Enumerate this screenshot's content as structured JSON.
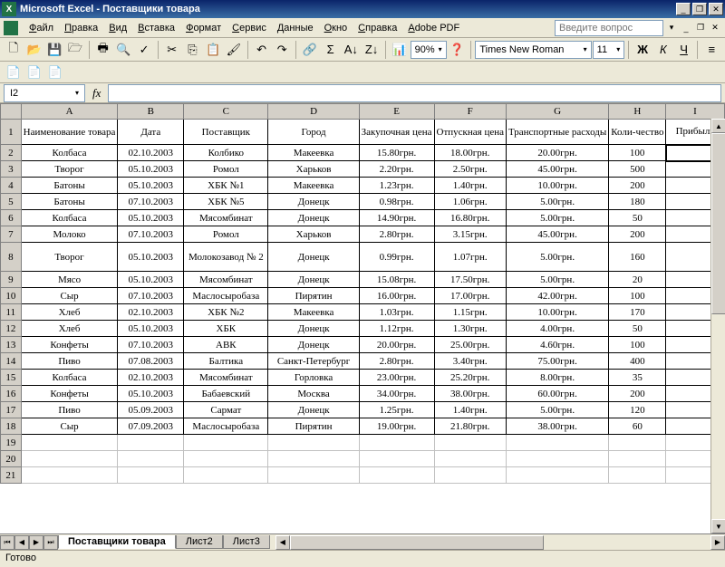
{
  "title": "Microsoft Excel - Поставщики товара",
  "menus": [
    "Файл",
    "Правка",
    "Вид",
    "Вставка",
    "Формат",
    "Сервис",
    "Данные",
    "Окно",
    "Справка",
    "Adobe PDF"
  ],
  "question_placeholder": "Введите вопрос",
  "font_name": "Times New Roman",
  "font_size": "11",
  "zoom": "90%",
  "namebox": "I2",
  "columns": [
    "A",
    "B",
    "C",
    "D",
    "E",
    "F",
    "G",
    "H",
    "I"
  ],
  "headers": [
    "Наименование товара",
    "Дата",
    "Поставщик",
    "Город",
    "Закупочная цена",
    "Отпускная цена",
    "Транспортные расходы",
    "Коли-чество",
    "Прибыль"
  ],
  "rows": [
    [
      "Колбаса",
      "02.10.2003",
      "Колбико",
      "Макеевка",
      "15.80грн.",
      "18.00грн.",
      "20.00грн.",
      "100",
      ""
    ],
    [
      "Творог",
      "05.10.2003",
      "Ромол",
      "Харьков",
      "2.20грн.",
      "2.50грн.",
      "45.00грн.",
      "500",
      ""
    ],
    [
      "Батоны",
      "05.10.2003",
      "ХБК №1",
      "Макеевка",
      "1.23грн.",
      "1.40грн.",
      "10.00грн.",
      "200",
      ""
    ],
    [
      "Батоны",
      "07.10.2003",
      "ХБК №5",
      "Донецк",
      "0.98грн.",
      "1.06грн.",
      "5.00грн.",
      "180",
      ""
    ],
    [
      "Колбаса",
      "05.10.2003",
      "Мясомбинат",
      "Донецк",
      "14.90грн.",
      "16.80грн.",
      "5.00грн.",
      "50",
      ""
    ],
    [
      "Молоко",
      "07.10.2003",
      "Ромол",
      "Харьков",
      "2.80грн.",
      "3.15грн.",
      "45.00грн.",
      "200",
      ""
    ],
    [
      "Творог",
      "05.10.2003",
      "Молокозавод № 2",
      "Донецк",
      "0.99грн.",
      "1.07грн.",
      "5.00грн.",
      "160",
      ""
    ],
    [
      "Мясо",
      "05.10.2003",
      "Мясомбинат",
      "Донецк",
      "15.08грн.",
      "17.50грн.",
      "5.00грн.",
      "20",
      ""
    ],
    [
      "Сыр",
      "07.10.2003",
      "Маслосыробаза",
      "Пирятин",
      "16.00грн.",
      "17.00грн.",
      "42.00грн.",
      "100",
      ""
    ],
    [
      "Хлеб",
      "02.10.2003",
      "ХБК №2",
      "Макеевка",
      "1.03грн.",
      "1.15грн.",
      "10.00грн.",
      "170",
      ""
    ],
    [
      "Хлеб",
      "05.10.2003",
      "ХБК",
      "Донецк",
      "1.12грн.",
      "1.30грн.",
      "4.00грн.",
      "50",
      ""
    ],
    [
      "Конфеты",
      "07.10.2003",
      "АВК",
      "Донецк",
      "20.00грн.",
      "25.00грн.",
      "4.60грн.",
      "100",
      ""
    ],
    [
      "Пиво",
      "07.08.2003",
      "Балтика",
      "Санкт-Петербург",
      "2.80грн.",
      "3.40грн.",
      "75.00грн.",
      "400",
      ""
    ],
    [
      "Колбаса",
      "02.10.2003",
      "Мясомбинат",
      "Горловка",
      "23.00грн.",
      "25.20грн.",
      "8.00грн.",
      "35",
      ""
    ],
    [
      "Конфеты",
      "05.10.2003",
      "Бабаевский",
      "Москва",
      "34.00грн.",
      "38.00грн.",
      "60.00грн.",
      "200",
      ""
    ],
    [
      "Пиво",
      "05.09.2003",
      "Сармат",
      "Донецк",
      "1.25грн.",
      "1.40грн.",
      "5.00грн.",
      "120",
      ""
    ],
    [
      "Сыр",
      "07.09.2003",
      "Маслосыробаза",
      "Пирятин",
      "19.00грн.",
      "21.80грн.",
      "38.00грн.",
      "60",
      ""
    ]
  ],
  "sheets": [
    "Поставщики товара",
    "Лист2",
    "Лист3"
  ],
  "status": "Готово",
  "bold": "Ж",
  "italic": "К",
  "underline": "Ч"
}
